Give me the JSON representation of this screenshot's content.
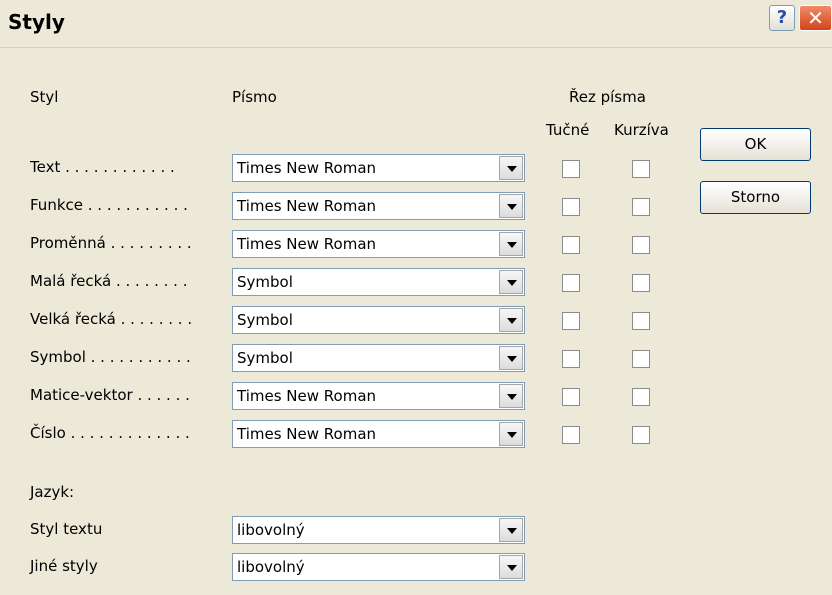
{
  "window": {
    "title": "Styly"
  },
  "titlebar": {
    "help_label": "?",
    "close_label": "✕"
  },
  "headers": {
    "style": "Styl",
    "font": "Písmo",
    "typeface": "Řez písma",
    "bold": "Tučné",
    "italic": "Kurzíva"
  },
  "buttons": {
    "ok": "OK",
    "cancel": "Storno"
  },
  "styles": [
    {
      "label": "Text . . . . . . . . . . . .",
      "font": "Times New Roman"
    },
    {
      "label": "Funkce . . . . . . . . . . .",
      "font": "Times New Roman"
    },
    {
      "label": "Proměnná . . . . . . . . .",
      "font": "Times New Roman"
    },
    {
      "label": "Malá řecká . . . . . . . .",
      "font": "Symbol"
    },
    {
      "label": "Velká řecká . . . . . . . .",
      "font": "Symbol"
    },
    {
      "label": "Symbol . . . . . . . . . . .",
      "font": "Symbol"
    },
    {
      "label": "Matice-vektor . . . . . .",
      "font": "Times New Roman"
    },
    {
      "label": "Číslo . . . . . . . . . . . . .",
      "font": "Times New Roman"
    }
  ],
  "language": {
    "heading": "Jazyk:",
    "text_style_label": "Styl textu",
    "text_style_value": "libovolný",
    "other_styles_label": "Jiné styly",
    "other_styles_value": "libovolný"
  },
  "icons": {
    "help": "help-icon",
    "close": "close-icon",
    "dropdown": "chevron-down-icon"
  }
}
